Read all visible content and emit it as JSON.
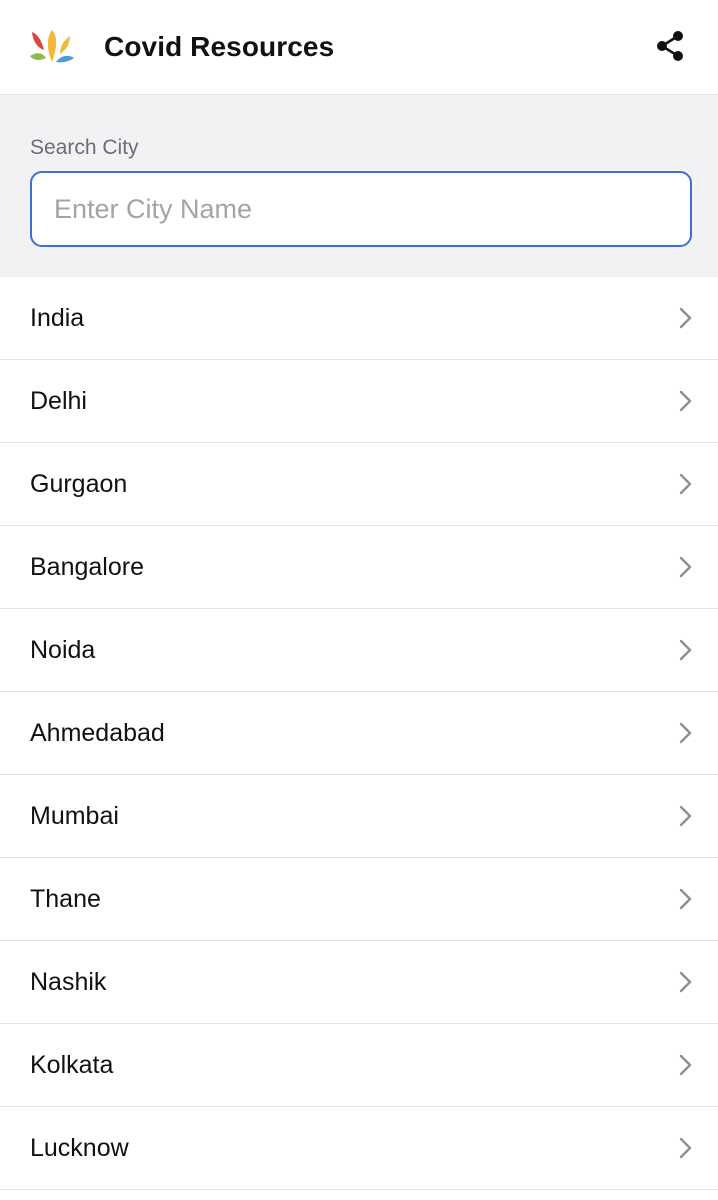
{
  "header": {
    "logo_icon": "fountain-logo",
    "title": "Covid Resources",
    "share_icon": "share-icon"
  },
  "search": {
    "label": "Search City",
    "placeholder": "Enter City Name",
    "value": "",
    "accent_color": "#3d6fd6"
  },
  "cities": [
    {
      "label": "India"
    },
    {
      "label": "Delhi"
    },
    {
      "label": "Gurgaon"
    },
    {
      "label": "Bangalore"
    },
    {
      "label": "Noida"
    },
    {
      "label": "Ahmedabad"
    },
    {
      "label": "Mumbai"
    },
    {
      "label": "Thane"
    },
    {
      "label": "Nashik"
    },
    {
      "label": "Kolkata"
    },
    {
      "label": "Lucknow"
    }
  ],
  "colors": {
    "logo_red": "#d9473f",
    "logo_yellow": "#f0b93c",
    "logo_green": "#8cbd4a",
    "logo_blue": "#4f9ad8"
  }
}
